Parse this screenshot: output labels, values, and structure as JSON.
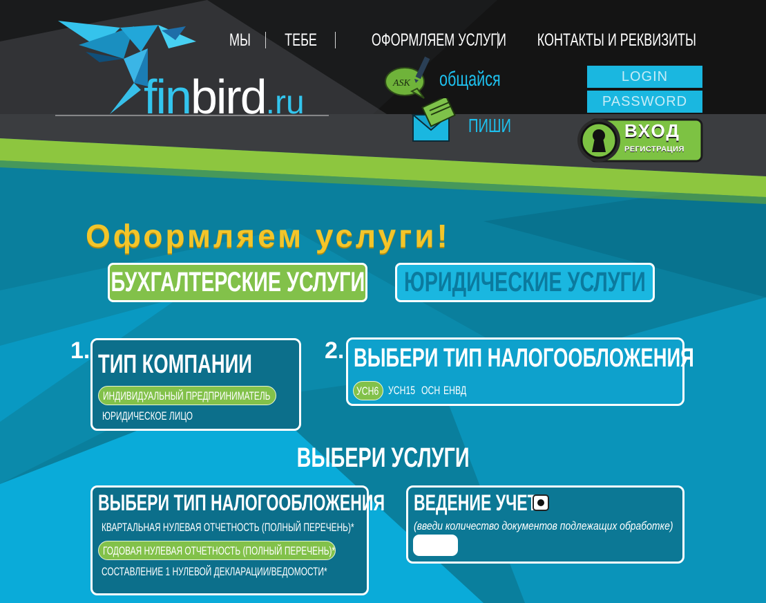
{
  "nav": {
    "items": [
      "МЫ",
      "ТЕБЕ",
      "ОФОРМЛЯЕМ УСЛУГИ",
      "КОНТАКТЫ И РЕКВИЗИТЫ"
    ]
  },
  "logo": {
    "fin": "fin",
    "bird": "bird",
    "ru": ".ru"
  },
  "contact": {
    "chat_label": "общайся",
    "chat_icon_text": "ASK",
    "write_label": "ПИШИ"
  },
  "auth": {
    "login_placeholder": "LOGIN",
    "password_placeholder": "PASSWORD",
    "enter_label": "ВХОД",
    "register_label": "РЕГИСТРАЦИЯ"
  },
  "main": {
    "title": "Оформляем услуги!",
    "service_tabs": [
      {
        "label": "БУХГАЛТЕРСКИЕ УСЛУГИ",
        "active": true
      },
      {
        "label": "ЮРИДИЧЕСКИЕ УСЛУГИ",
        "active": false
      }
    ]
  },
  "step1": {
    "number": "1.",
    "title": "ТИП КОМПАНИИ",
    "options": [
      {
        "label": "ИНДИВИДУАЛЬНЫЙ ПРЕДПРИНИМАТЕЛЬ",
        "selected": true
      },
      {
        "label": "ЮРИДИЧЕСКОЕ ЛИЦО",
        "selected": false
      }
    ]
  },
  "step2": {
    "number": "2.",
    "title": "ВЫБЕРИ ТИП НАЛОГООБЛОЖЕНИЯ",
    "options": [
      {
        "label": "УСН6",
        "selected": true
      },
      {
        "label": "УСН15",
        "selected": false
      },
      {
        "label": "ОСН",
        "selected": false
      },
      {
        "label": "ЕНВД",
        "selected": false
      }
    ]
  },
  "services": {
    "title": "ВЫБЕРИ УСЛУГИ",
    "left_card": {
      "title": "ВЫБЕРИ ТИП НАЛОГООБЛОЖЕНИЯ",
      "options": [
        {
          "label": "КВАРТАЛЬНАЯ НУЛЕВАЯ ОТЧЕТНОСТЬ (ПОЛНЫЙ ПЕРЕЧЕНЬ)*",
          "selected": false
        },
        {
          "label": "ГОДОВАЯ НУЛЕВАЯ ОТЧЕТНОСТЬ (ПОЛНЫЙ ПЕРЕЧЕНЬ)*",
          "selected": true
        },
        {
          "label": "СОСТАВЛЕНИЕ 1 НУЛЕВОЙ ДЕКЛАРАЦИИ/ВЕДОМОСТИ*",
          "selected": false
        }
      ]
    },
    "right_card": {
      "title": "ВЕДЕНИЕ УЧЕТА",
      "hint": "(введи количество документов подлежащих обработке)",
      "radio_checked": true,
      "count_value": ""
    }
  },
  "colors": {
    "accent_green": "#82c14a",
    "accent_blue": "#1ab7e0",
    "title_yellow": "#f3c52a",
    "dark_band": "#1a1a1a"
  }
}
